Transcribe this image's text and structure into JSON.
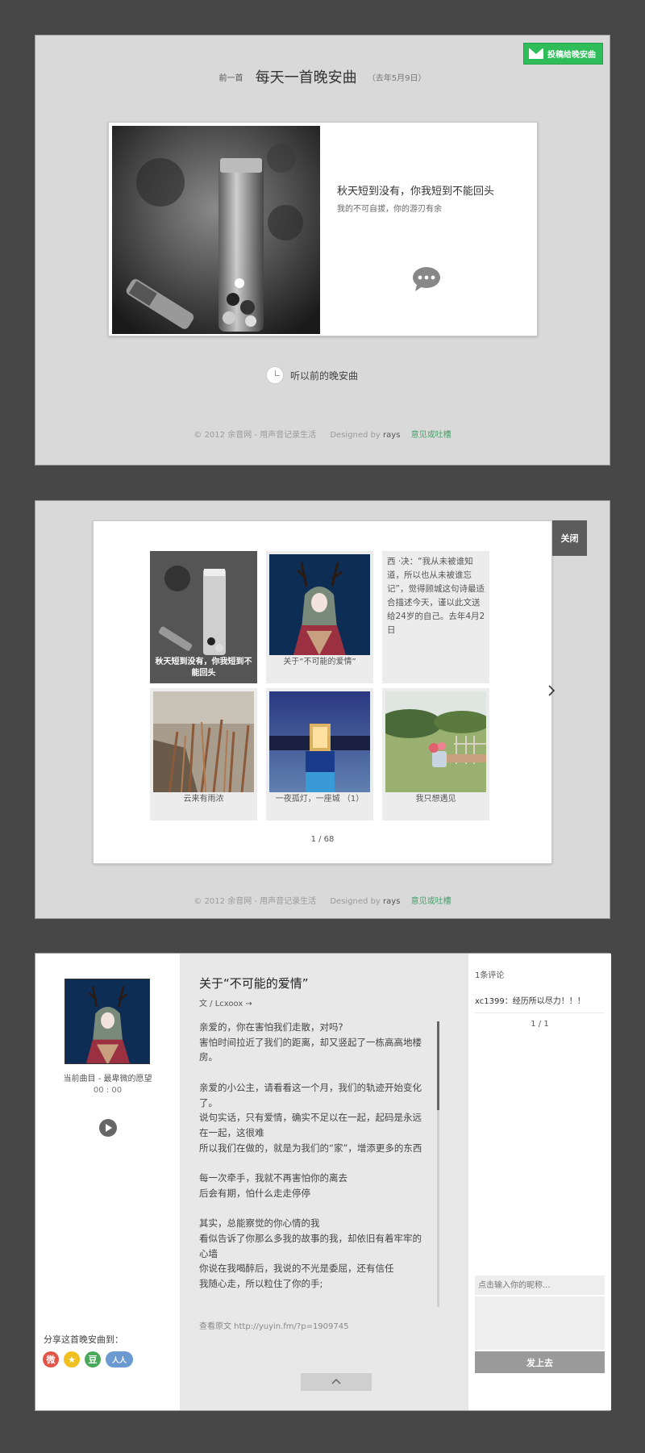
{
  "panel1": {
    "submit_label": "投稿给晚安曲",
    "prev_label": "前一首",
    "title": "每天一首晚安曲",
    "date": "（去年5月9日）",
    "song_title": "秋天短到没有，你我短到不能回头",
    "song_subtitle": "我的不可自拔，你的游刃有余",
    "older_label": "听以前的晚安曲",
    "footer": {
      "copyright": "© 2012 余音网 - 用声音记录生活",
      "designed": "Designed by",
      "designer": "rays",
      "feedback": "意见或吐槽"
    }
  },
  "panel2": {
    "close_label": "关闭",
    "tiles": [
      {
        "caption": "秋天短到没有，你我短到不能回头"
      },
      {
        "caption": "关于“不可能的爱情”"
      },
      {
        "text": "西 ·决：“我从未被谁知道，所以也从未被谁忘记”，觉得顾城这句诗最适合描述今天，谨以此文送给24岁的自己。去年4月2日"
      },
      {
        "caption": "云来有雨浓"
      },
      {
        "caption": "一夜孤灯，一座城 （1）"
      },
      {
        "caption": "我只想遇见"
      }
    ],
    "pager": "1 / 68",
    "footer": {
      "copyright": "© 2012 余音网 - 用声音记录生活",
      "designed": "Designed by",
      "designer": "rays",
      "feedback": "意见或吐槽"
    }
  },
  "panel3": {
    "current_track": "当前曲目 - 最卑微的愿望",
    "time": "00 : 00",
    "share_label": "分享这首晚安曲到：",
    "share_icons": [
      "weibo-icon",
      "qzone-icon",
      "douban-icon",
      "renren-icon"
    ],
    "article_title": "关于“不可能的爱情”",
    "author": "文 / Lcxoox →",
    "paragraphs": [
      "亲爱的，你在害怕我们走散，对吗?\n害怕时间拉近了我们的距离，却又竖起了一栋高高地楼房。",
      "亲爱的小公主，请看看这一个月，我们的轨迹开始变化了。\n说句实话，只有爱情，确实不足以在一起，起码是永远在一起，这很难\n所以我们在做的，就是为我们的“家”，增添更多的东西",
      "每一次牵手，我就不再害怕你的离去\n后会有期，怕什么走走停停",
      "其实，总能察觉的你心情的我\n看似告诉了你那么多我的故事的我，却依旧有着牢牢的心墙\n你说在我喝醉后，我说的不光是委屈，还有信任\n我随心走，所以粒住了你的手;"
    ],
    "source": "查看原文 http://yuyin.fm/?p=1909745",
    "comment_count": "1条评论",
    "comment": "xc1399：经历所以尽力！！！",
    "comment_pager": "1 / 1",
    "nick_placeholder": "点击输入你的昵称...",
    "send_label": "发上去"
  },
  "colors": {
    "accent_green": "#2ebd59",
    "link_green": "#47a06a",
    "dark_tile": "#555555"
  }
}
